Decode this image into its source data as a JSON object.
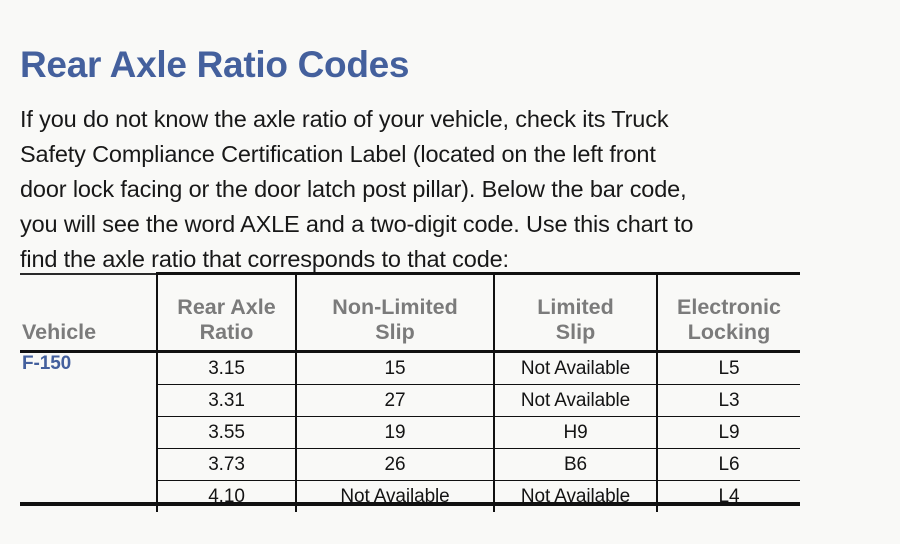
{
  "document": {
    "title": "Rear Axle Ratio Codes",
    "intro_lines": [
      "If you do not know the axle ratio of your vehicle, check its Truck",
      "Safety Compliance Certification Label (located on the left front",
      "door lock facing or the door latch post pillar). Below the bar code,",
      "you will see the word AXLE and a two-digit code. Use this chart to",
      "find the axle ratio that corresponds to that code:"
    ]
  },
  "colors": {
    "title_blue": "#44609d",
    "header_gray": "#7b7b7b",
    "body_text": "#141414",
    "rule": "#111111",
    "background": "#f9f9f7"
  },
  "table": {
    "headers": [
      "Vehicle",
      "Rear Axle Ratio",
      "Non-Limited Slip",
      "Limited Slip",
      "Electronic Locking"
    ],
    "header_lines": [
      [
        "Vehicle"
      ],
      [
        "Rear Axle",
        "Ratio"
      ],
      [
        "Non-Limited",
        "Slip"
      ],
      [
        "Limited",
        "Slip"
      ],
      [
        "Electronic",
        "Locking"
      ]
    ],
    "vehicle": "F-150",
    "rows": [
      {
        "vehicle": "F-150",
        "rear_axle_ratio": "3.15",
        "non_limited_slip": "15",
        "limited_slip": "Not Available",
        "electronic_locking": "L5"
      },
      {
        "vehicle": "",
        "rear_axle_ratio": "3.31",
        "non_limited_slip": "27",
        "limited_slip": "Not Available",
        "electronic_locking": "L3"
      },
      {
        "vehicle": "",
        "rear_axle_ratio": "3.55",
        "non_limited_slip": "19",
        "limited_slip": "H9",
        "electronic_locking": "L9"
      },
      {
        "vehicle": "",
        "rear_axle_ratio": "3.73",
        "non_limited_slip": "26",
        "limited_slip": "B6",
        "electronic_locking": "L6"
      },
      {
        "vehicle": "",
        "rear_axle_ratio": "4.10",
        "non_limited_slip": "Not Available",
        "limited_slip": "Not Available",
        "electronic_locking": "L4"
      }
    ]
  }
}
